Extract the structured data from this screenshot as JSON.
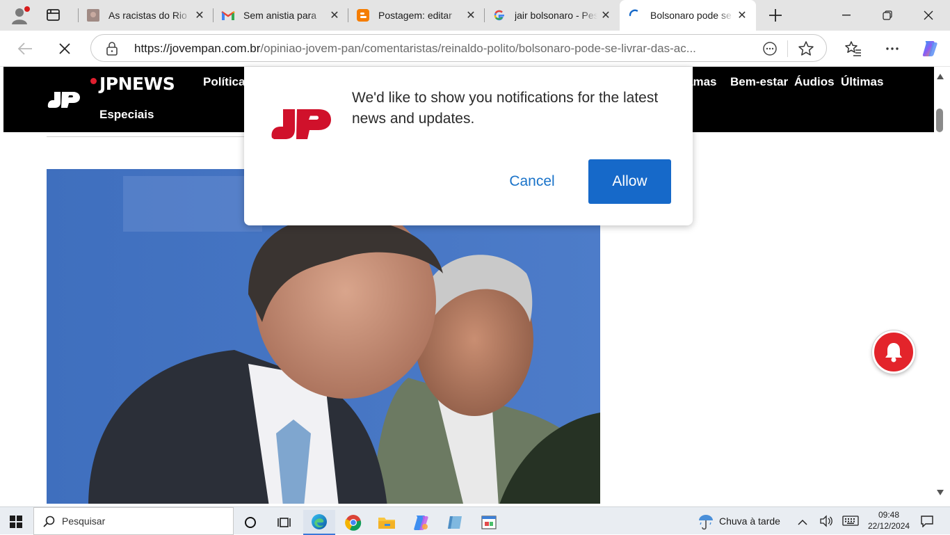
{
  "browser": {
    "tabs": [
      {
        "title": "As racistas do Rio",
        "active": false,
        "favicon": "page-thumbnail-icon"
      },
      {
        "title": "Sem anistia para",
        "active": false,
        "favicon": "gmail-icon"
      },
      {
        "title": "Postagem: editar",
        "active": false,
        "favicon": "blogger-icon"
      },
      {
        "title": "jair bolsonaro - Pesquisa",
        "active": false,
        "favicon": "google-icon"
      },
      {
        "title": "Bolsonaro pode se",
        "active": true,
        "favicon": "loading-spinner-icon"
      }
    ],
    "new_tab": "+",
    "url_host": "https://jovempan.com.br",
    "url_path": "/opiniao-jovem-pan/comentaristas/reinaldo-polito/bolsonaro-pode-se-livrar-das-ac..."
  },
  "site": {
    "logo_text": "JPNEWS",
    "nav": [
      "Política",
      "amas",
      "Bem-estar",
      "Áudios",
      "Últimas",
      "Especiais"
    ]
  },
  "notification": {
    "message": "We'd like to show you notifications for the latest news and updates.",
    "cancel": "Cancel",
    "allow": "Allow",
    "accent_color": "#1669c9",
    "brand_color": "#d0112b"
  },
  "taskbar": {
    "search_placeholder": "Pesquisar",
    "weather": "Chuva à tarde",
    "time": "09:48",
    "date": "22/12/2024"
  }
}
